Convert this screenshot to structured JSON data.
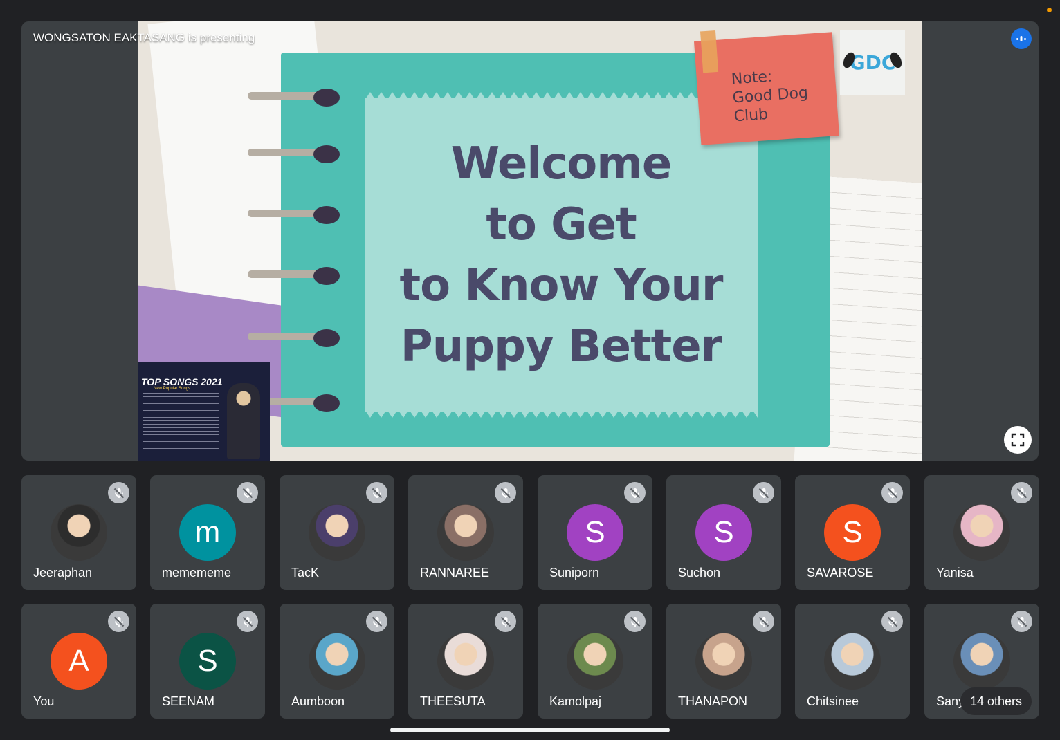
{
  "presentation": {
    "presenter_label": "WONGSATON EAKTASANG is presenting",
    "slide": {
      "title_lines": [
        "Welcome",
        "to Get",
        "to Know Your",
        "Puppy Better"
      ],
      "sticky_note": [
        "Note:",
        "Good Dog",
        "Club"
      ],
      "logo_text": "GDC",
      "thumbnail_title": "TOP SONGS 2021",
      "thumbnail_subtitle": "New Popular Songs"
    }
  },
  "participants": [
    {
      "name": "Jeeraphan",
      "initial": "",
      "color": "#2d2d2d",
      "photo": true
    },
    {
      "name": "memememe",
      "initial": "m",
      "color": "#00929f",
      "photo": false
    },
    {
      "name": "TacK",
      "initial": "",
      "color": "#4b3f6b",
      "photo": true
    },
    {
      "name": "RANNAREE",
      "initial": "",
      "color": "#8a6f66",
      "photo": true
    },
    {
      "name": "Suniporn",
      "initial": "S",
      "color": "#a142c2",
      "photo": false
    },
    {
      "name": "Suchon",
      "initial": "S",
      "color": "#a142c2",
      "photo": false
    },
    {
      "name": "SAVAROSE",
      "initial": "S",
      "color": "#f4511e",
      "photo": false
    },
    {
      "name": "Yanisa",
      "initial": "",
      "color": "#e6b6c6",
      "photo": true
    },
    {
      "name": "You",
      "initial": "A",
      "color": "#f4511e",
      "photo": false
    },
    {
      "name": "SEENAM",
      "initial": "S",
      "color": "#0b5345",
      "photo": false
    },
    {
      "name": "Aumboon",
      "initial": "",
      "color": "#5aa6c9",
      "photo": true
    },
    {
      "name": "THEESUTA",
      "initial": "",
      "color": "#e9dcd8",
      "photo": true
    },
    {
      "name": "Kamolpaj",
      "initial": "",
      "color": "#6d8a4e",
      "photo": true
    },
    {
      "name": "THANAPON",
      "initial": "",
      "color": "#c7a38c",
      "photo": true
    },
    {
      "name": "Chitsinee",
      "initial": "",
      "color": "#b8c9d9",
      "photo": true
    },
    {
      "name": "Sany",
      "initial": "",
      "color": "#6a8fb8",
      "photo": true
    }
  ],
  "others_label": "14 others"
}
